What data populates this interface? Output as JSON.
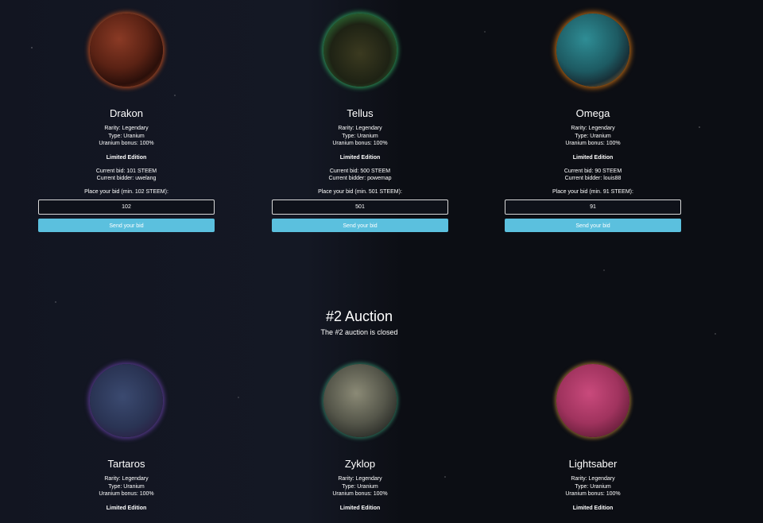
{
  "auction1": [
    {
      "name": "Drakon",
      "rarity": "Rarity: Legendary",
      "type": "Type: Uranium",
      "bonus": "Uranium bonus: 100%",
      "edition": "Limited Edition",
      "current_bid": "Current bid: 101 STEEM",
      "current_bidder": "Current bidder: uwelang",
      "bid_prompt": "Place your bid (min. 102 STEEM):",
      "bid_value": "102",
      "button_label": "Send your bid",
      "planet_icon": "planet-drakon"
    },
    {
      "name": "Tellus",
      "rarity": "Rarity: Legendary",
      "type": "Type: Uranium",
      "bonus": "Uranium bonus: 100%",
      "edition": "Limited Edition",
      "current_bid": "Current bid: 500 STEEM",
      "current_bidder": "Current bidder: powemap",
      "bid_prompt": "Place your bid (min. 501 STEEM):",
      "bid_value": "501",
      "button_label": "Send your bid",
      "planet_icon": "planet-tellus"
    },
    {
      "name": "Omega",
      "rarity": "Rarity: Legendary",
      "type": "Type: Uranium",
      "bonus": "Uranium bonus: 100%",
      "edition": "Limited Edition",
      "current_bid": "Current bid: 90 STEEM",
      "current_bidder": "Current bidder: louis88",
      "bid_prompt": "Place your bid (min. 91 STEEM):",
      "bid_value": "91",
      "button_label": "Send your bid",
      "planet_icon": "planet-omega"
    }
  ],
  "auction2": {
    "title": "#2 Auction",
    "subtitle": "The #2 auction is closed",
    "cards": [
      {
        "name": "Tartaros",
        "rarity": "Rarity: Legendary",
        "type": "Type: Uranium",
        "bonus": "Uranium bonus: 100%",
        "edition": "Limited Edition",
        "planet_icon": "planet-tartaros"
      },
      {
        "name": "Zyklop",
        "rarity": "Rarity: Legendary",
        "type": "Type: Uranium",
        "bonus": "Uranium bonus: 100%",
        "edition": "Limited Edition",
        "planet_icon": "planet-zyklop"
      },
      {
        "name": "Lightsaber",
        "rarity": "Rarity: Legendary",
        "type": "Type: Uranium",
        "bonus": "Uranium bonus: 100%",
        "edition": "Limited Edition",
        "planet_icon": "planet-lightsaber"
      }
    ]
  },
  "colors": {
    "button": "#5bc0de",
    "background": "#0d1018"
  }
}
